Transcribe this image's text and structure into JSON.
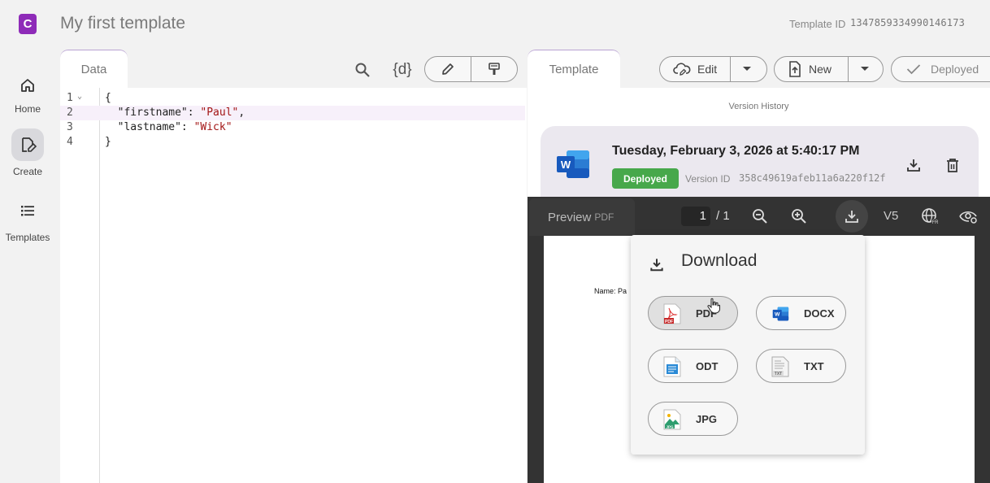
{
  "app": {
    "logo_letter": "C",
    "title": "My first template",
    "template_id_label": "Template ID",
    "template_id": "1347859334990146173"
  },
  "nav": [
    {
      "label": "Home",
      "icon": "home-icon"
    },
    {
      "label": "Create",
      "icon": "create-icon"
    },
    {
      "label": "Templates",
      "icon": "list-icon"
    }
  ],
  "data_panel": {
    "tab": "Data",
    "curly_label": "{d}",
    "lines": [
      {
        "n": "1",
        "key": "",
        "val": "",
        "raw": "{"
      },
      {
        "n": "2",
        "key": "  \"firstname\": ",
        "val": "\"Paul\"",
        "tail": ","
      },
      {
        "n": "3",
        "key": "  \"lastname\": ",
        "val": "\"Wick\"",
        "tail": ""
      },
      {
        "n": "4",
        "key": "",
        "val": "",
        "raw": "}"
      }
    ]
  },
  "template_panel": {
    "tab": "Template",
    "edit_label": "Edit",
    "new_label": "New",
    "deployed_label": "Deployed",
    "version_history": "Version History",
    "version": {
      "date": "Tuesday, February 3, 2026 at 5:40:17 PM",
      "status": "Deployed",
      "id_label": "Version ID",
      "id": "358c49619afeb11a6a220f12f"
    }
  },
  "preview": {
    "tab": "Preview",
    "tab_small": "PDF",
    "page_current": "1",
    "page_total": "/ 1",
    "version": "V5"
  },
  "pdf_text": "Name: Pa",
  "download": {
    "title": "Download",
    "formats": [
      {
        "label": "PDF",
        "icon": "pdf-file-icon"
      },
      {
        "label": "DOCX",
        "icon": "word-file-icon"
      },
      {
        "label": "ODT",
        "icon": "odt-file-icon"
      },
      {
        "label": "TXT",
        "icon": "txt-file-icon"
      },
      {
        "label": "JPG",
        "icon": "jpg-file-icon"
      }
    ]
  },
  "colors": {
    "brand": "#8e2bb8",
    "deployed_badge": "#47a84b",
    "word_blue": "#185abd"
  }
}
